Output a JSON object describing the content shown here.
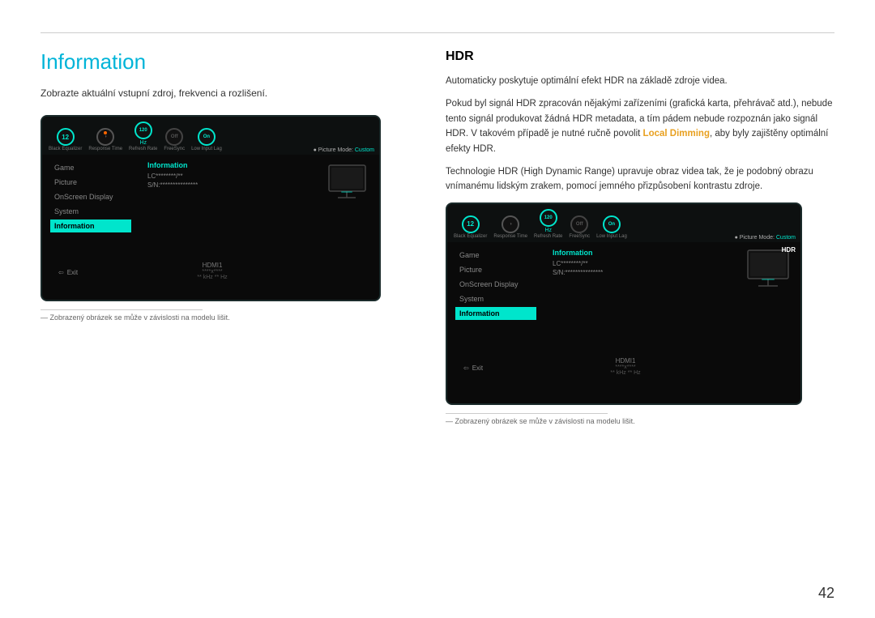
{
  "page": {
    "number": "42"
  },
  "left": {
    "title": "Information",
    "description": "Zobrazte aktuální vstupní zdroj, frekvenci a rozlišení.",
    "footnote": "― Zobrazený obrázek se může v závislosti na modelu lišit."
  },
  "right": {
    "title": "HDR",
    "paragraphs": [
      "Automaticky poskytuje optimální efekt HDR na základě zdroje videa.",
      "Pokud byl signál HDR zpracován nějakými zařízeními (grafická karta, přehrávač atd.), nebude tento signál produkovat žádná HDR metadata, a tím pádem nebude rozpoznán jako signál HDR. V takovém případě je nutné ručně povolit Local Dimming, aby byly zajištěny optimální efekty HDR.",
      "Technologie HDR (High Dynamic Range) upravuje obraz videa tak, že je podobný obrazu vnímanému lidským zrakem, pomocí jemného přizpůsobení kontrastu zdroje."
    ],
    "highlight": "Local Dimming",
    "footnote": "― Zobrazený obrázek se může v závislosti na modelu lišit."
  },
  "monitor": {
    "knobs": [
      {
        "value": "12",
        "label": "Black Equalizer"
      },
      {
        "value": "",
        "label": "Response Time",
        "is_dial": true
      },
      {
        "value": "120",
        "sub": "Hz",
        "label": "Refresh Rate"
      },
      {
        "value": "Off",
        "label": "FreeSync"
      },
      {
        "value": "On",
        "label": "Low Input Lag"
      }
    ],
    "picture_mode": "● Picture Mode: Custom",
    "menu_items": [
      "Game",
      "Picture",
      "OnScreen Display",
      "System",
      "Information"
    ],
    "active_menu": "Information",
    "info_title": "Information",
    "info_lines": [
      "LC*******/**",
      "S/N:***************"
    ],
    "source": "HDMI1",
    "resolution": "****x****",
    "hz": "** kHz ** Hz",
    "exit_label": "Exit"
  }
}
